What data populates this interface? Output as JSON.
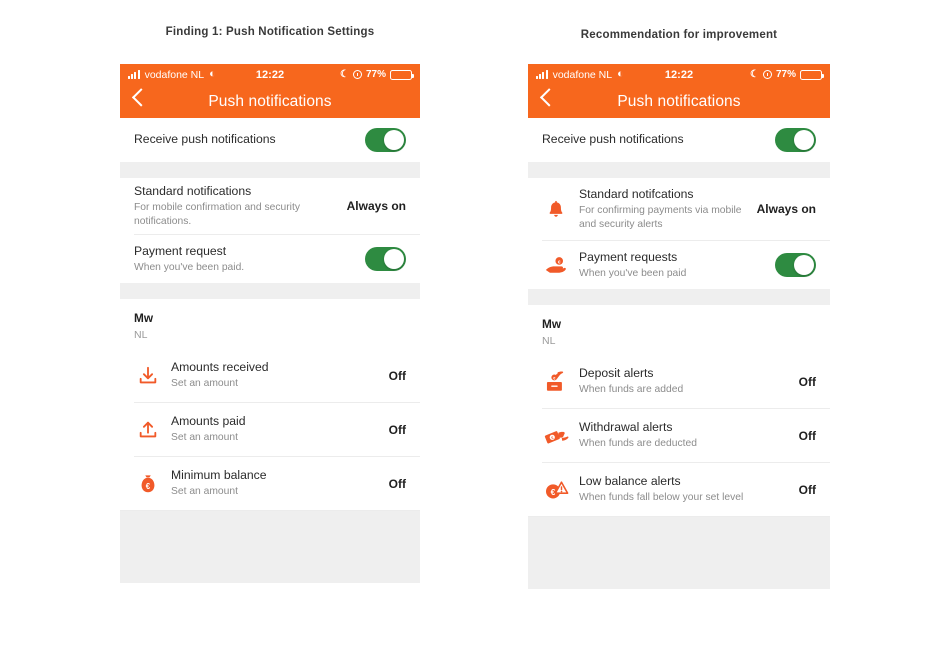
{
  "captions": {
    "left": "Finding 1: Push Notification Settings",
    "right": "Recommendation for improvement"
  },
  "colors": {
    "brand_orange": "#f7671d",
    "icon_orange": "#f15a29",
    "toggle_green": "#2e8b41",
    "battery_yellow": "#ffcc00",
    "band_grey": "#efefef",
    "divider_grey": "#ececec"
  },
  "status_bar": {
    "carrier": "vodafone NL",
    "wifi_icon": "wifi-icon",
    "time": "12:22",
    "moon_icon": "moon-icon",
    "alarm_icon": "alarm-icon",
    "battery_percent": "77%",
    "battery_icon": "battery-icon"
  },
  "nav": {
    "back_icon": "chevron-left-icon",
    "title": "Push notifications"
  },
  "left_panel": {
    "master": {
      "label": "Receive push notifications",
      "toggle": "on"
    },
    "items": [
      {
        "icon": "none",
        "title": "Standard notifications",
        "sub": "For mobile confirmation and security notifications.",
        "value": "Always on",
        "control": "text"
      },
      {
        "icon": "none",
        "title": "Payment request",
        "sub": "When you've been paid.",
        "value": "on",
        "control": "toggle"
      }
    ],
    "account": {
      "name": "Mw",
      "sub": "NL"
    },
    "alerts": [
      {
        "icon": "download-tray-icon",
        "title": "Amounts received",
        "sub": "Set an amount",
        "value": "Off"
      },
      {
        "icon": "upload-tray-icon",
        "title": "Amounts paid",
        "sub": "Set an amount",
        "value": "Off"
      },
      {
        "icon": "money-bag-euro-icon",
        "title": "Minimum balance",
        "sub": "Set an amount",
        "value": "Off"
      }
    ]
  },
  "right_panel": {
    "master": {
      "label": "Receive push notifications",
      "toggle": "on"
    },
    "items": [
      {
        "icon": "bell-icon",
        "title": "Standard notifcations",
        "sub": "For confirming payments via mobile and security alerts",
        "value": "Always on",
        "control": "text"
      },
      {
        "icon": "hand-coin-icon",
        "title": "Payment requests",
        "sub": "When you've been paid",
        "value": "on",
        "control": "toggle"
      }
    ],
    "account": {
      "name": "Mw",
      "sub": "NL"
    },
    "alerts": [
      {
        "icon": "deposit-hand-box-icon",
        "title": "Deposit alerts",
        "sub": "When funds are added",
        "value": "Off"
      },
      {
        "icon": "withdrawal-hand-note-icon",
        "title": "Withdrawal alerts",
        "sub": "When funds are deducted",
        "value": "Off"
      },
      {
        "icon": "low-balance-warning-icon",
        "title": "Low balance alerts",
        "sub": "When funds fall below your set level",
        "value": "Off"
      }
    ]
  }
}
